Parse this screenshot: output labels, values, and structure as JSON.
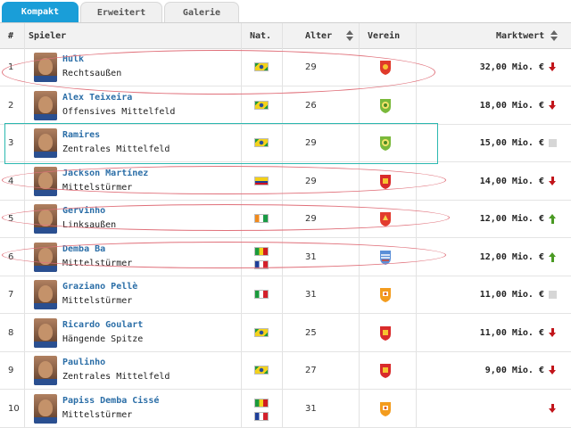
{
  "tabs": [
    {
      "label": "Kompakt",
      "active": true
    },
    {
      "label": "Erweitert",
      "active": false
    },
    {
      "label": "Galerie",
      "active": false
    }
  ],
  "columns": {
    "rank": "#",
    "player": "Spieler",
    "nat": "Nat.",
    "age": "Alter",
    "club": "Verein",
    "value": "Marktwert"
  },
  "rows": [
    {
      "rank": "1",
      "name": "Hulk",
      "position": "Rechtsaußen",
      "nat": [
        "brazil"
      ],
      "age": "29",
      "club": "shanghai-sipg",
      "value": "32,00 Mio. €",
      "trend": "down"
    },
    {
      "rank": "2",
      "name": "Alex Teixeira",
      "position": "Offensives Mittelfeld",
      "nat": [
        "brazil"
      ],
      "age": "26",
      "club": "jiangsu-suning",
      "value": "18,00 Mio. €",
      "trend": "down"
    },
    {
      "rank": "3",
      "name": "Ramires",
      "position": "Zentrales Mittelfeld",
      "nat": [
        "brazil"
      ],
      "age": "29",
      "club": "jiangsu-suning",
      "value": "15,00 Mio. €",
      "trend": "same"
    },
    {
      "rank": "4",
      "name": "Jackson Martínez",
      "position": "Mittelstürmer",
      "nat": [
        "colombia"
      ],
      "age": "29",
      "club": "guangzhou-evergrande",
      "value": "14,00 Mio. €",
      "trend": "down"
    },
    {
      "rank": "5",
      "name": "Gervinho",
      "position": "Linksaußen",
      "nat": [
        "ivory-coast"
      ],
      "age": "29",
      "club": "hebei-cffc",
      "value": "12,00 Mio. €",
      "trend": "up"
    },
    {
      "rank": "6",
      "name": "Demba Ba",
      "position": "Mittelstürmer",
      "nat": [
        "senegal",
        "france"
      ],
      "age": "31",
      "club": "shanghai-shenhua",
      "value": "12,00 Mio. €",
      "trend": "up"
    },
    {
      "rank": "7",
      "name": "Graziano Pellè",
      "position": "Mittelstürmer",
      "nat": [
        "italy"
      ],
      "age": "31",
      "club": "shandong-luneng",
      "value": "11,00 Mio. €",
      "trend": "same"
    },
    {
      "rank": "8",
      "name": "Ricardo Goulart",
      "position": "Hängende Spitze",
      "nat": [
        "brazil"
      ],
      "age": "25",
      "club": "guangzhou-evergrande",
      "value": "11,00 Mio. €",
      "trend": "down"
    },
    {
      "rank": "9",
      "name": "Paulinho",
      "position": "Zentrales Mittelfeld",
      "nat": [
        "brazil"
      ],
      "age": "27",
      "club": "guangzhou-evergrande",
      "value": "9,00 Mio. €",
      "trend": "down"
    },
    {
      "rank": "10",
      "name": "Papiss Demba Cissé",
      "position": "Mittelstürmer",
      "nat": [
        "senegal",
        "france"
      ],
      "age": "31",
      "club": "shandong-luneng",
      "value": "",
      "trend": "down"
    }
  ],
  "colors": {
    "accent": "#1a9ed8",
    "link": "#2b6ea7",
    "trend_down": "#c2151b",
    "trend_up": "#4a9a23",
    "annotation_ellipse": "#e0707a",
    "annotation_rect": "#2bb8b0"
  }
}
